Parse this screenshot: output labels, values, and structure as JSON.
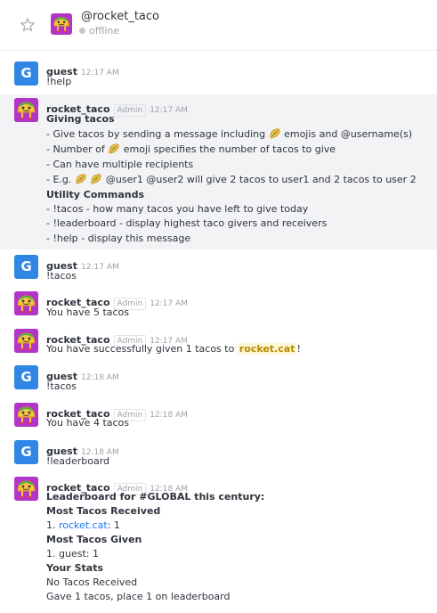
{
  "room": {
    "prefix": "@",
    "name": "rocket_taco",
    "status": "offline"
  },
  "colors": {
    "guest_avatar": "#2f86e4",
    "bot_avatar": "#b234c8",
    "mention_bg": "#fff6d6",
    "link": "#1d74f5"
  },
  "messages": [
    {
      "user": "guest",
      "time": "12:17 AM",
      "text": "!help"
    },
    {
      "user": "rocket_taco",
      "role": "Admin",
      "time": "12:17 AM",
      "heading1": "Giving tacos",
      "l1a": "- Give tacos by sending a message including ",
      "l1b": " emojis and @username(s)",
      "l2a": "- Number of ",
      "l2b": " emoji specifies the number of tacos to give",
      "l3": "- Can have multiple recipients",
      "l4a": "- E.g. ",
      "l4b": " @user1 @user2 will give 2 tacos to user1 and 2 tacos to user 2",
      "heading2": "Utility Commands",
      "l5": "- !tacos - how many tacos you have left to give today",
      "l6": "- !leaderboard - display highest taco givers and receivers",
      "l7": "- !help - display this message"
    },
    {
      "user": "guest",
      "time": "12:17 AM",
      "text": "!tacos"
    },
    {
      "user": "rocket_taco",
      "role": "Admin",
      "time": "12:17 AM",
      "text": "You have 5 tacos"
    },
    {
      "user": "rocket_taco",
      "role": "Admin",
      "time": "12:17 AM",
      "text_a": "You have successfully given 1 tacos to ",
      "mention": "rocket.cat",
      "text_b": "!"
    },
    {
      "user": "guest",
      "time": "12:18 AM",
      "text": "!tacos"
    },
    {
      "user": "rocket_taco",
      "role": "Admin",
      "time": "12:18 AM",
      "text": "You have 4 tacos"
    },
    {
      "user": "guest",
      "time": "12:18 AM",
      "text": "!leaderboard"
    },
    {
      "user": "rocket_taco",
      "role": "Admin",
      "time": "12:18 AM",
      "title": "Leaderboard for #GLOBAL this century:",
      "received_heading": "Most Tacos Received",
      "received_rank": "1. ",
      "received_user": "rocket.cat",
      "received_count": ": 1",
      "given_heading": "Most Tacos Given",
      "given_line": "1. guest: 1",
      "stats_heading": "Your Stats",
      "stats_line1": "No Tacos Received",
      "stats_line2": "Gave 1 tacos, place 1 on leaderboard"
    }
  ]
}
